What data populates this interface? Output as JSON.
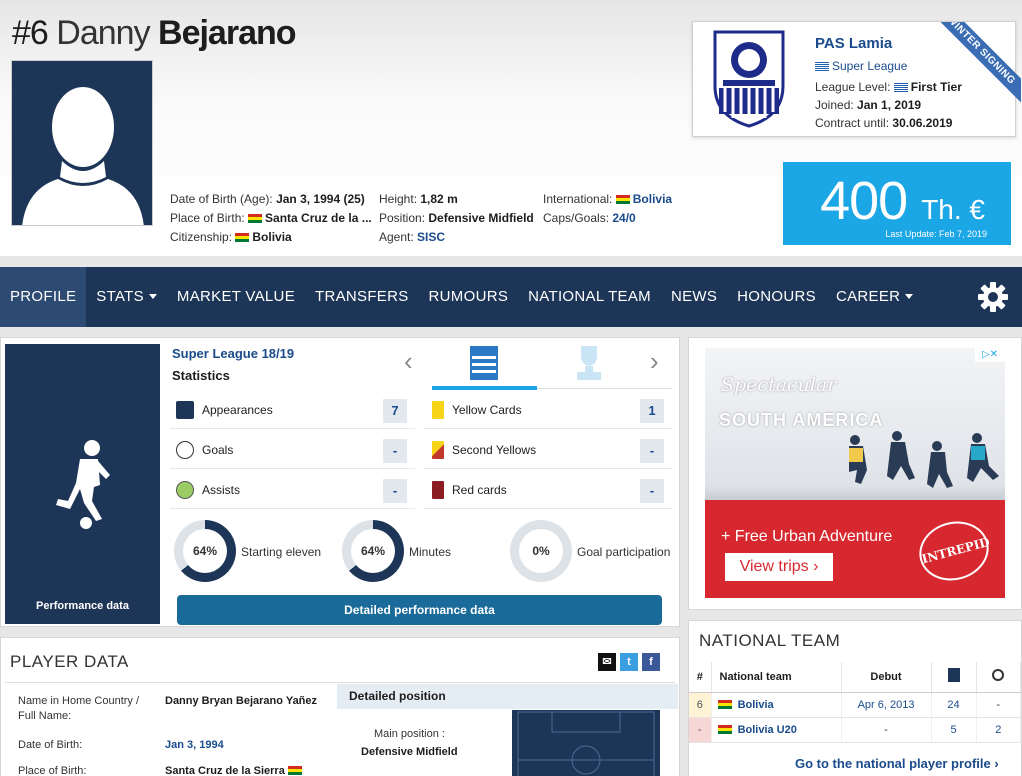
{
  "player": {
    "number": "#6",
    "first_name": "Danny",
    "last_name": "Bejarano",
    "dob_label": "Date of Birth (Age):",
    "dob_value": "Jan 3, 1994 (25)",
    "pob_label": "Place of Birth:",
    "pob_value": "Santa Cruz de la ...",
    "cit_label": "Citizenship:",
    "cit_value": "Bolivia",
    "height_label": "Height:",
    "height_value": "1,82 m",
    "position_label": "Position:",
    "position_value": "Defensive Midfield",
    "agent_label": "Agent:",
    "agent_value": "SISC",
    "intl_label": "International:",
    "intl_value": "Bolivia",
    "caps_label": "Caps/Goals:",
    "caps_value": "24/0"
  },
  "club": {
    "name": "PAS Lamia",
    "league": "Super League",
    "level_label": "League Level:",
    "level_value": "First Tier",
    "joined_label": "Joined:",
    "joined_value": "Jan 1, 2019",
    "contract_label": "Contract until:",
    "contract_value": "30.06.2019",
    "ribbon": "WINTER SIGNING"
  },
  "market_value": {
    "amount": "400",
    "unit": "Th. €",
    "update": "Last Update: Feb 7, 2019"
  },
  "nav": {
    "items": [
      "PROFILE",
      "STATS",
      "MARKET VALUE",
      "TRANSFERS",
      "RUMOURS",
      "NATIONAL TEAM",
      "NEWS",
      "HONOURS",
      "CAREER"
    ]
  },
  "performance": {
    "league": "Super League 18/19",
    "statistics": "Statistics",
    "side_label": "Performance data",
    "stats": {
      "appearances_label": "Appearances",
      "appearances": "7",
      "goals_label": "Goals",
      "goals": "-",
      "assists_label": "Assists",
      "assists": "-",
      "yellow_label": "Yellow Cards",
      "yellow": "1",
      "second_yellow_label": "Second Yellows",
      "second_yellow": "-",
      "red_label": "Red cards",
      "red": "-"
    },
    "donuts": [
      {
        "value": "64%",
        "pct": 64,
        "label": "Starting eleven"
      },
      {
        "value": "64%",
        "pct": 64,
        "label": "Minutes"
      },
      {
        "value": "0%",
        "pct": 0,
        "label": "Goal participation"
      }
    ],
    "button": "Detailed performance data"
  },
  "ad": {
    "subtitle": "Spectacular",
    "title": "SOUTH AMERICA",
    "tagline": "+ Free Urban Adventure",
    "button": "View trips ›",
    "logo": "INTREPID",
    "close": "▷✕"
  },
  "player_data": {
    "title": "PLAYER DATA",
    "name_label": "Name in Home Country / Full Name:",
    "name_value": "Danny Bryan Bejarano Yañez",
    "dob_label": "Date of Birth:",
    "dob_value": "Jan 3, 1994",
    "pob_label": "Place of Birth:",
    "pob_value": "Santa Cruz de la Sierra",
    "detailed_position": "Detailed position",
    "main_position_label": "Main position :",
    "main_position_value": "Defensive Midfield"
  },
  "national_team": {
    "title": "NATIONAL TEAM",
    "headers": [
      "#",
      "National team",
      "Debut"
    ],
    "rows": [
      {
        "num": "6",
        "team": "Bolivia",
        "debut": "Apr 6, 2013",
        "caps": "24",
        "goals": "-"
      },
      {
        "num": "-",
        "team": "Bolivia U20",
        "debut": "-",
        "caps": "5",
        "goals": "2"
      }
    ],
    "link": "Go to the national player profile ›"
  }
}
